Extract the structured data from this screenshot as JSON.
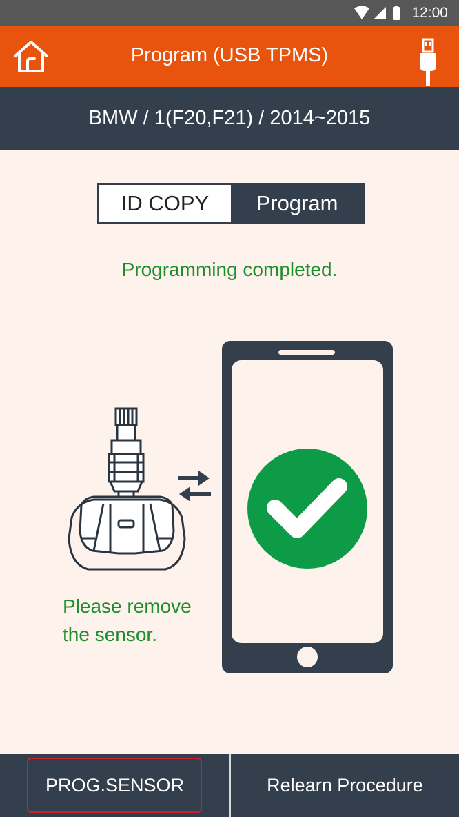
{
  "status_bar": {
    "time": "12:00"
  },
  "app_bar": {
    "title": "Program (USB TPMS)",
    "home_icon": "home-icon",
    "connection_icon": "usb-plug-icon"
  },
  "vehicle": {
    "path": "BMW / 1(F20,F21) / 2014~2015"
  },
  "mode_toggle": {
    "options": [
      "ID COPY",
      "Program"
    ],
    "selected": "Program"
  },
  "status": {
    "message": "Programming completed.",
    "color": "#1c8f2c"
  },
  "instruction": {
    "line1": "Please remove",
    "line2": "the sensor."
  },
  "bottom": {
    "prog_sensor": "PROG.SENSOR",
    "relearn": "Relearn Procedure"
  },
  "colors": {
    "accent": "#e8530e",
    "dark": "#333f4c",
    "success": "#0d9b47",
    "background": "#fdf3ec"
  }
}
